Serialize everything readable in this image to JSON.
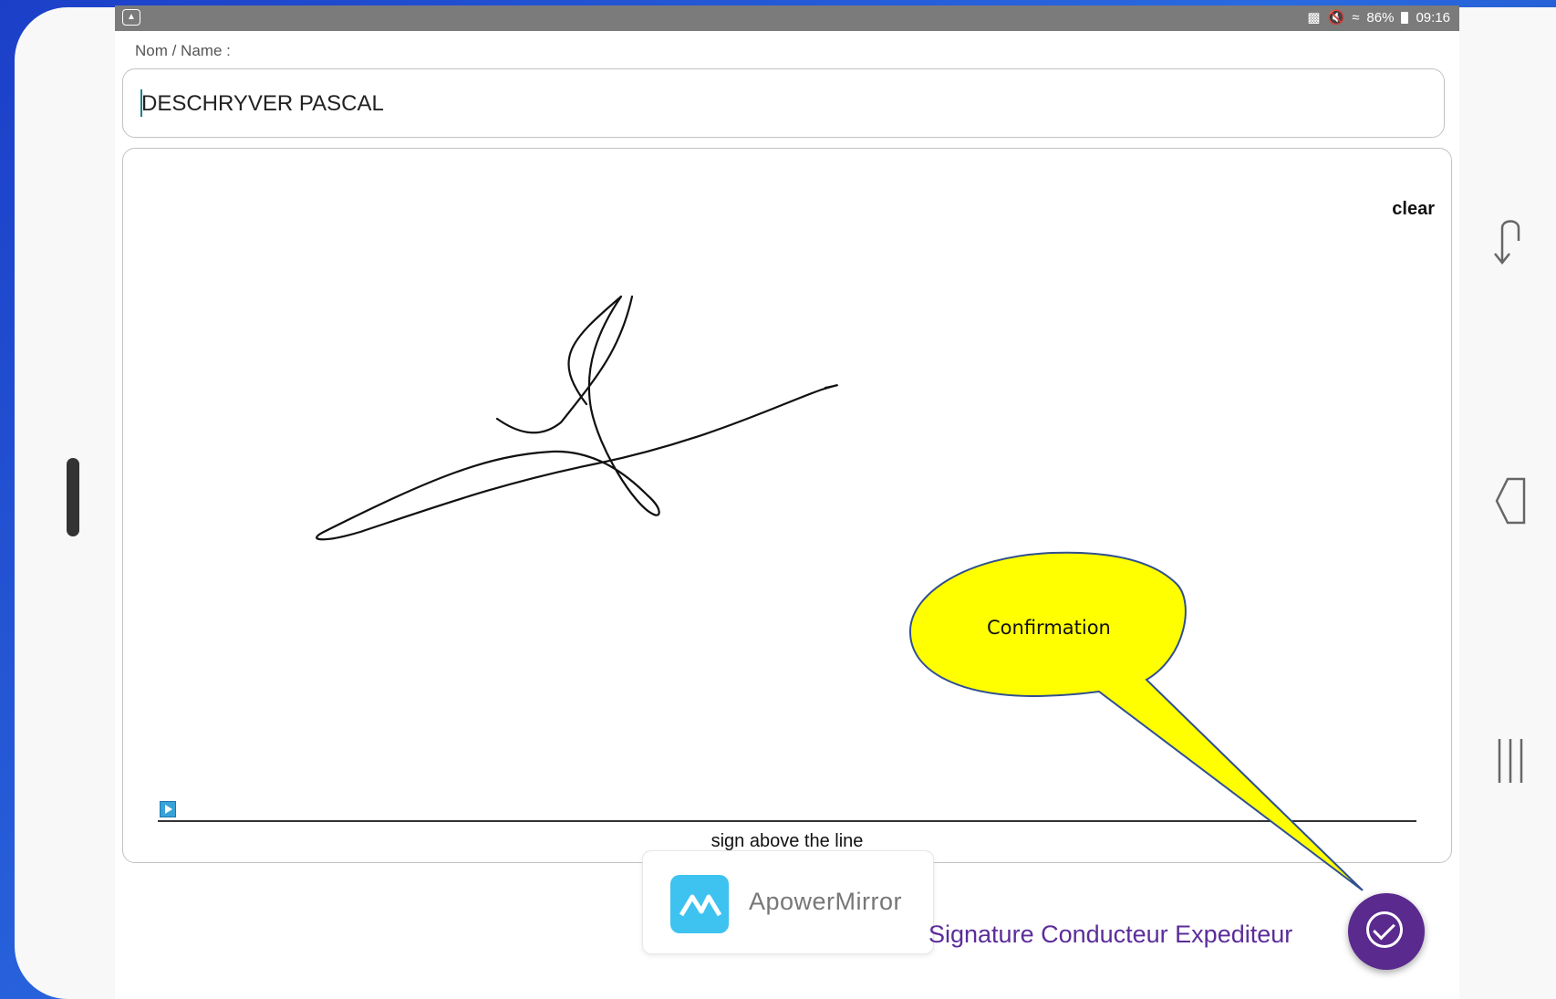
{
  "statusbar": {
    "left_icon": "gallery-icon",
    "battery": "86%",
    "time": "09:16",
    "icons": [
      "cast-icon",
      "mute-icon",
      "wifi-icon",
      "battery-icon"
    ]
  },
  "form": {
    "name_label": "Nom / Name :",
    "name_value": "DESCHRYVER PASCAL"
  },
  "signature_pad": {
    "clear_label": "clear",
    "caption": "sign above the line"
  },
  "overlay": {
    "app_name": "ApowerMirror"
  },
  "footer": {
    "title": "Signature Conducteur Expediteur"
  },
  "annotation": {
    "callout_label": "Confirmation",
    "callout_color": "#ffff00",
    "callout_border": "#2f4f8f"
  },
  "colors": {
    "accent": "#5a2a8e",
    "statusbar": "#7b7b7b",
    "background": "#1c3fc8"
  },
  "nav_icons": [
    "rotate-icon",
    "back-icon",
    "recent-apps-icon"
  ]
}
